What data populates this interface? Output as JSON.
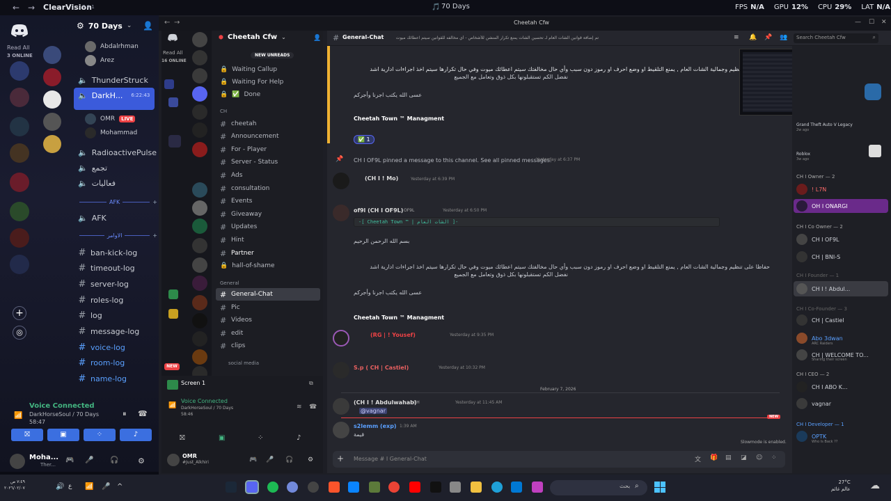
{
  "topbar": {
    "app_name": "ClearVision",
    "app_version": "7.0.1",
    "center_title": "70 Days",
    "fps_label": "FPS",
    "fps_val": "N/A",
    "gpu_label": "GPU",
    "gpu_val": "12%",
    "cpu_label": "CPU",
    "cpu_val": "29%",
    "lat_label": "LAT",
    "lat_val": "N/A"
  },
  "left_app": {
    "server_name": "70 Days",
    "read_all": "Read All",
    "online": "3 ONLINE",
    "voice_users": [
      {
        "name": "Abdalrhman"
      },
      {
        "name": "Arez"
      }
    ],
    "channels": [
      {
        "name": "ThunderStruck",
        "type": "voice"
      },
      {
        "name": "DarkH...",
        "type": "voice",
        "time": "6:22:43",
        "active": true
      },
      {
        "name": "OMR",
        "type": "user",
        "badge": "LIVE"
      },
      {
        "name": "Mohammad",
        "type": "user"
      },
      {
        "name": "RadioactivePulse",
        "type": "voice"
      },
      {
        "name": "تجمع",
        "type": "voice"
      },
      {
        "name": "فعاليات",
        "type": "voice"
      }
    ],
    "afk_header": "AFK",
    "afk_channel": "AFK",
    "section_header": "الاوامر",
    "log_channels": [
      "ban-kick-log",
      "timeout-log",
      "server-log",
      "roles-log",
      "log",
      "message-log",
      "voice-log",
      "room-log",
      "name-log"
    ],
    "voice_connected": "Voice Connected",
    "voice_sub": "DarkHorseSoul / 70 Days",
    "voice_time": "58:47",
    "user_name": "Moha...",
    "user_status": "Ther..."
  },
  "inner": {
    "window_title": "Cheetah Cfw",
    "read_all": "Read All",
    "online": "16 ONLINE",
    "server_name": "Cheetah Cfw",
    "new_unreads": "NEW UNREADS",
    "channels_top": [
      "Waiting Callup",
      "Waiting For Help",
      "Done"
    ],
    "cat_ch": "CH",
    "channels_ch": [
      "cheetah",
      "Announcement",
      "For - Player",
      "Server - Status",
      "Ads",
      "consultation",
      "Events",
      "Giveaway",
      "Updates",
      "Hint",
      "Partner",
      "hall-of-shame"
    ],
    "cat_general": "General",
    "channels_general": [
      "General-Chat",
      "Pic",
      "Videos",
      "edit",
      "clips"
    ],
    "cat_social": "social media",
    "screen_label": "Screen 1",
    "voice_connected": "Voice Connected",
    "voice_sub": "DarkHorseSoul / 70 Days",
    "voice_time": "58:46",
    "user_name": "OMR",
    "user_status": "#Just_Alkhiri",
    "channel_header": "General-Chat",
    "topic": "تم إضافة قوانين الشات العام لـ تحسين الشات يمنع تكرار المنشن للأشخاص - أي مخالفه للقوانين سيتم اعطائك ميوت",
    "search_placeholder": "Search Cheetah Cfw",
    "messages": {
      "rules_para_1": "حفاظا على تنظيم وجمالية الشات العام , يمنع التلقيط او وضع احرف او رموز دون سبب وأي حال مخالفتك سيتم اعطائك ميوت وفي حال تكرارها سيتم اخذ اجراءات ادارية اشد",
      "rules_para_2": "نفضل الكم تستقبلونها بكل ذوق وتعامل مع الجميع",
      "rules_para_3": "عسى الله يكتب اجرنا وأجركم",
      "signature": "Cheetah Town ™ Managment",
      "reaction_count": "1",
      "pinned_text": "CH I OF9L pinned a message to this channel. See all pinned messages.",
      "pinned_time": "Yesterday at 6:37 PM",
      "msg1_author": "(CH I ! Mo)",
      "msg1_time": "Yesterday at 6:39 PM",
      "msg2_author": "of9l (CH I OF9L)",
      "msg2_tag": "OF9L",
      "msg2_time": "Yesterday at 6:50 PM",
      "msg2_code": "-[ Cheetah Town ™ | الشات العام ]-",
      "msg2_bismillah": "بسم الله الرحمن الرحيم",
      "msg3_author": "(RG | ! Yousef)",
      "msg3_time": "Yesterday at 9:35 PM",
      "msg4_author": "S.p ( CH | Castiel)",
      "msg4_time": "Yesterday at 10:32 PM",
      "date_divider": "February 7, 2026",
      "msg5_author": "(CH I ! Abdulwahab)",
      "msg5_tag": "CH",
      "msg5_time": "Yesterday at 11:45 AM",
      "msg5_text": "@vagnar",
      "msg6_author": "s2lemm (exp)",
      "msg6_time": "1:39 AM",
      "msg6_text": "قيمة",
      "new_badge": "NEW",
      "slowmode": "Slowmode is enabled.",
      "composer_placeholder": "Message # I General-Chat"
    },
    "members": {
      "activity1": "Grand Theft Auto V Legacy",
      "activity1_time": "2w ago",
      "activity2": "Roblox",
      "activity2_time": "3w ago",
      "groups": [
        {
          "title": "CH I Owner — 2",
          "members": [
            "! L7N",
            "OH I ONARGI"
          ]
        },
        {
          "title": "CH I Co Owner — 2",
          "members": [
            "CH I OF9L",
            "CH | BNI-S"
          ]
        },
        {
          "title": "CH I Founder — 1",
          "members": [
            "CH I ! Abdul..."
          ]
        },
        {
          "title": "CH I Co-Founder — 3",
          "members": [
            "CH | Castiel",
            "Abo 3dwan",
            "CH | WELCOME TO..."
          ]
        },
        {
          "title": "CH I CEO — 2",
          "members": [
            "CH I ABO K...",
            "vagnar"
          ]
        },
        {
          "title": "CH I Developer — 1",
          "members": [
            "OPTK"
          ]
        }
      ],
      "sub_arc": "ARC Raiders",
      "sub_screen": "Sharing their screen",
      "sub_who": "Who Is Back ??"
    }
  },
  "taskbar": {
    "search_placeholder": "بحث",
    "temp": "27°C",
    "weather": "عالم غائم",
    "clock_time": "٧:٤٩ ص",
    "clock_date": "٢٠٢٦/٠٢/٠٧"
  },
  "colors": {
    "accent": "#5865f2",
    "active_channel": "#3b5bdb",
    "live": "#ed4245",
    "online": "#23a55a",
    "brand_link": "#00a8fc"
  }
}
